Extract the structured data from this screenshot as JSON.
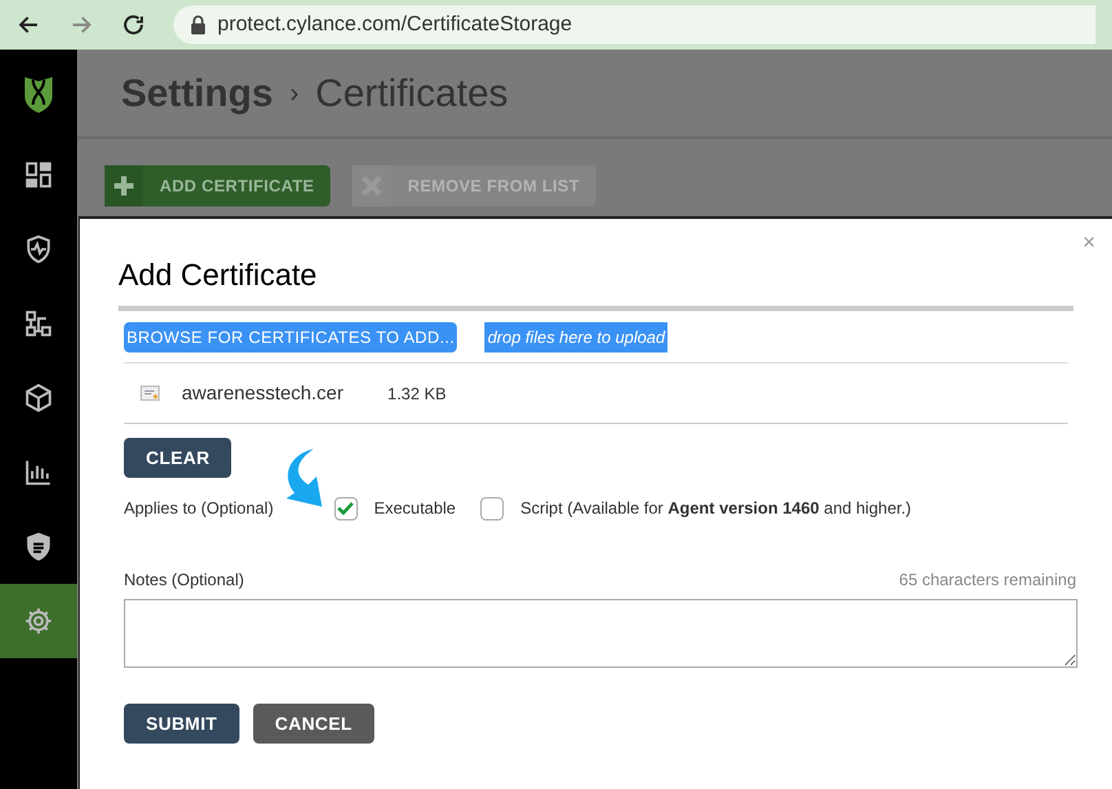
{
  "browser": {
    "url": "protect.cylance.com/CertificateStorage"
  },
  "sidebar": {
    "items": [
      {
        "kind": "dashboard",
        "selected": false
      },
      {
        "kind": "protection",
        "selected": false
      },
      {
        "kind": "zones",
        "selected": false
      },
      {
        "kind": "assets",
        "selected": false
      },
      {
        "kind": "reports",
        "selected": false
      },
      {
        "kind": "policy",
        "selected": false
      },
      {
        "kind": "settings",
        "selected": true
      }
    ]
  },
  "header": {
    "crumbs": [
      "Settings",
      "Certificates"
    ],
    "separator": "›"
  },
  "toolbar": [
    {
      "label": "ADD CERTIFICATE",
      "kind": "add",
      "disabled": false
    },
    {
      "label": "REMOVE FROM LIST",
      "kind": "remove",
      "disabled": true
    }
  ],
  "dialog": {
    "title": "Add Certificate",
    "close": "×",
    "browse": "BROWSE FOR CERTIFICATES TO ADD...",
    "drop_hint": "drop files here to upload",
    "files": [
      {
        "name": "awarenesstech.cer",
        "size": "1.32 KB"
      }
    ],
    "clear": "CLEAR",
    "applies_label": "Applies to (Optional)",
    "options": [
      {
        "label": "Executable",
        "checked": true
      },
      {
        "label": "Script (Available for **Agent version 1460** and higher.)",
        "checked": false
      }
    ],
    "notes": {
      "label": "Notes (Optional)",
      "remaining": "65 characters remaining"
    },
    "buttons": [
      {
        "label": "SUBMIT",
        "kind": "primary"
      },
      {
        "label": "CANCEL",
        "kind": "secondary"
      }
    ]
  }
}
